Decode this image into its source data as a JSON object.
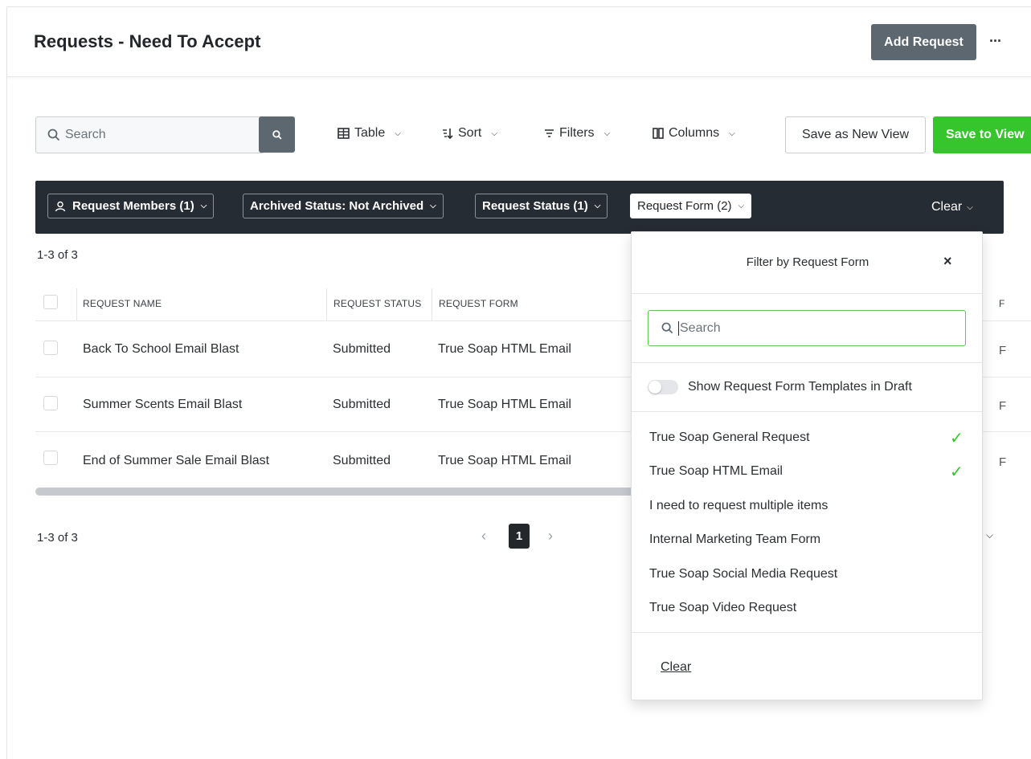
{
  "header": {
    "title": "Requests - Need To Accept",
    "add_button": "Add Request",
    "more": "···"
  },
  "toolbar": {
    "search_placeholder": "Search",
    "table_label": "Table",
    "sort_label": "Sort",
    "filters_label": "Filters",
    "columns_label": "Columns",
    "save_as_new_view": "Save as New View",
    "save_to_view": "Save to View"
  },
  "filter_chips": [
    {
      "label": "Request Members (1)"
    },
    {
      "label": "Archived Status: Not Archived"
    },
    {
      "label": "Request Status (1)"
    },
    {
      "label": "Request Form (2)"
    }
  ],
  "filter_clear": "Clear",
  "result_count_top": "1-3 of 3",
  "result_count_bottom": "1-3 of 3",
  "table": {
    "columns": [
      "REQUEST NAME",
      "REQUEST STATUS",
      "REQUEST FORM",
      "F"
    ],
    "rows": [
      {
        "name": "Back To School Email Blast",
        "status": "Submitted",
        "form": "True Soap HTML Email",
        "trail": "F"
      },
      {
        "name": "Summer Scents Email Blast",
        "status": "Submitted",
        "form": "True Soap HTML Email",
        "trail": "F"
      },
      {
        "name": "End of Summer Sale Email Blast",
        "status": "Submitted",
        "form": "True Soap HTML Email",
        "trail": "F"
      }
    ]
  },
  "pagination": {
    "prev": "‹",
    "current": "1",
    "next": "›"
  },
  "dropdown": {
    "title": "Filter by Request Form",
    "close": "×",
    "search_placeholder": "Search",
    "toggle_label": "Show Request Form Templates in Draft",
    "items": [
      {
        "label": "True Soap General Request",
        "checked": true
      },
      {
        "label": "True Soap HTML Email",
        "checked": true
      },
      {
        "label": "I need to request multiple items",
        "checked": false
      },
      {
        "label": "Internal Marketing Team Form",
        "checked": false
      },
      {
        "label": "True Soap Social Media Request",
        "checked": false
      },
      {
        "label": "True Soap Video Request",
        "checked": false
      }
    ],
    "check_mark": "✓",
    "clear": "Clear"
  },
  "colors": {
    "accent_green": "#36c52c",
    "dark_bar": "#262c33",
    "button_gray": "#5c6770"
  }
}
